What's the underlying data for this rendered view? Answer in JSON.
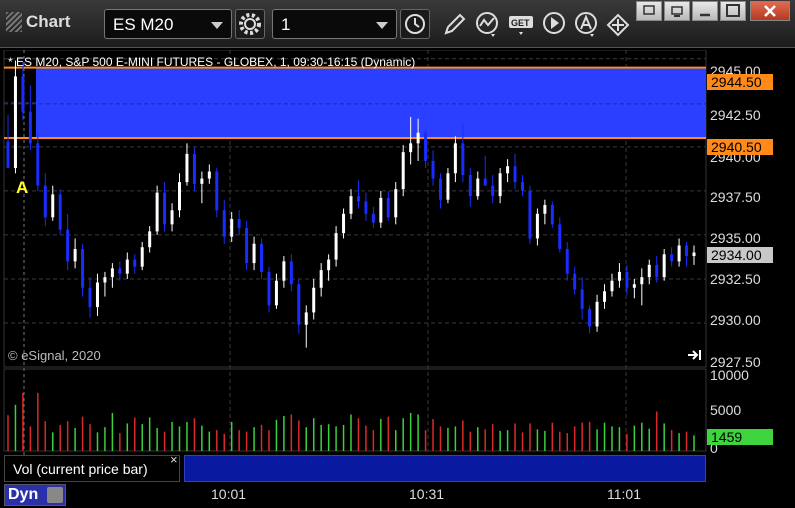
{
  "toolbar": {
    "app_title": "Chart",
    "symbol": "ES M20",
    "interval": "1",
    "icons": [
      "clock-icon",
      "pencil-icon",
      "study-icon",
      "get-icon",
      "play-icon",
      "alert-icon",
      "arrows-icon"
    ]
  },
  "window": {
    "buttons": [
      "restore",
      "minimize",
      "maximize",
      "close"
    ]
  },
  "chart_info": {
    "title_line": "* ES M20, S&P 500 E-MINI FUTURES - GLOBEX, 1, 09:30-16:15 (Dynamic)",
    "copyright": "© eSignal, 2020",
    "marker": "A"
  },
  "price_axis": {
    "labels": [
      "2945.00",
      "2942.50",
      "2940.00",
      "2937.50",
      "2935.00",
      "2932.50",
      "2930.00",
      "2927.50"
    ],
    "tag_high": "2944.50",
    "tag_low": "2940.50",
    "tag_last": "2934.00"
  },
  "volume_axis": {
    "labels": [
      "10000",
      "5000",
      "0"
    ],
    "tag_last": "1459"
  },
  "volume_panel": {
    "label": "Vol (current price bar)",
    "close": "×"
  },
  "time_axis": {
    "labels": [
      "10:01",
      "10:31",
      "11:01"
    ]
  },
  "bottom": {
    "dyn_label": "Dyn"
  },
  "colors": {
    "up": "#ffffff",
    "down": "#1a2cff",
    "zone": "#2a3fff",
    "zone_line": "#ff8a1a",
    "vol_up": "#3bd13b",
    "vol_down": "#d92a2a",
    "last_tag": "#c8c8c8",
    "vol_tag": "#3ed43e"
  },
  "chart_data": {
    "type": "candlestick",
    "ylim": [
      2927.5,
      2945.5
    ],
    "zone": [
      2940.5,
      2944.5
    ],
    "candles": [
      [
        2940.3,
        2941.8,
        2939.5,
        2938.8
      ],
      [
        2938.8,
        2944.9,
        2938.5,
        2944.0
      ],
      [
        2944.0,
        2944.8,
        2941.5,
        2942.0
      ],
      [
        2942.0,
        2943.5,
        2939.8,
        2940.2
      ],
      [
        2940.2,
        2940.8,
        2937.5,
        2937.8
      ],
      [
        2937.8,
        2938.5,
        2935.5,
        2936.0
      ],
      [
        2936.0,
        2937.8,
        2935.8,
        2937.3
      ],
      [
        2937.3,
        2937.6,
        2935.0,
        2935.3
      ],
      [
        2935.3,
        2936.2,
        2933.0,
        2933.5
      ],
      [
        2933.5,
        2934.8,
        2933.1,
        2934.2
      ],
      [
        2934.2,
        2934.5,
        2931.5,
        2932.0
      ],
      [
        2932.0,
        2932.6,
        2930.3,
        2930.9
      ],
      [
        2930.9,
        2932.8,
        2930.4,
        2932.3
      ],
      [
        2932.3,
        2932.9,
        2931.5,
        2932.6
      ],
      [
        2932.6,
        2933.4,
        2932.0,
        2933.1
      ],
      [
        2933.1,
        2933.5,
        2932.4,
        2932.8
      ],
      [
        2932.8,
        2934.0,
        2932.5,
        2933.6
      ],
      [
        2933.6,
        2933.9,
        2932.8,
        2933.2
      ],
      [
        2933.2,
        2934.6,
        2933.0,
        2934.3
      ],
      [
        2934.3,
        2935.5,
        2934.0,
        2935.2
      ],
      [
        2935.2,
        2937.8,
        2935.0,
        2937.4
      ],
      [
        2937.4,
        2938.0,
        2935.2,
        2935.6
      ],
      [
        2935.6,
        2936.8,
        2935.2,
        2936.4
      ],
      [
        2936.4,
        2938.5,
        2936.0,
        2938.0
      ],
      [
        2938.0,
        2940.2,
        2937.8,
        2939.6
      ],
      [
        2939.6,
        2940.0,
        2937.5,
        2937.9
      ],
      [
        2937.9,
        2938.6,
        2936.8,
        2938.2
      ],
      [
        2938.2,
        2939.0,
        2937.9,
        2938.6
      ],
      [
        2938.6,
        2938.8,
        2936.0,
        2936.4
      ],
      [
        2936.4,
        2937.0,
        2934.5,
        2934.9
      ],
      [
        2934.9,
        2936.3,
        2934.6,
        2935.9
      ],
      [
        2935.9,
        2936.4,
        2935.0,
        2935.4
      ],
      [
        2935.4,
        2935.8,
        2933.0,
        2933.4
      ],
      [
        2933.4,
        2934.9,
        2933.0,
        2934.5
      ],
      [
        2934.5,
        2934.8,
        2932.5,
        2932.9
      ],
      [
        2932.9,
        2933.2,
        2930.6,
        2931.0
      ],
      [
        2931.0,
        2932.8,
        2930.8,
        2932.4
      ],
      [
        2932.4,
        2933.8,
        2932.0,
        2933.5
      ],
      [
        2933.5,
        2933.9,
        2931.8,
        2932.2
      ],
      [
        2932.2,
        2932.5,
        2929.4,
        2929.9
      ],
      [
        2929.9,
        2931.0,
        2928.6,
        2930.6
      ],
      [
        2930.6,
        2932.5,
        2930.2,
        2932.0
      ],
      [
        2932.0,
        2933.4,
        2931.5,
        2933.0
      ],
      [
        2933.0,
        2933.9,
        2932.4,
        2933.6
      ],
      [
        2933.6,
        2935.5,
        2933.2,
        2935.1
      ],
      [
        2935.1,
        2936.5,
        2934.8,
        2936.2
      ],
      [
        2936.2,
        2937.6,
        2935.9,
        2937.2
      ],
      [
        2937.2,
        2938.1,
        2936.5,
        2936.9
      ],
      [
        2936.9,
        2937.4,
        2935.8,
        2936.2
      ],
      [
        2936.2,
        2936.6,
        2935.4,
        2935.7
      ],
      [
        2935.7,
        2937.5,
        2935.4,
        2937.1
      ],
      [
        2937.1,
        2937.5,
        2935.8,
        2936.0
      ],
      [
        2936.0,
        2938.0,
        2935.6,
        2937.6
      ],
      [
        2937.6,
        2940.1,
        2937.2,
        2939.7
      ],
      [
        2939.7,
        2941.7,
        2939.0,
        2940.2
      ],
      [
        2940.2,
        2941.6,
        2939.2,
        2940.8
      ],
      [
        2940.8,
        2941.0,
        2938.8,
        2939.2
      ],
      [
        2939.2,
        2939.8,
        2937.8,
        2938.2
      ],
      [
        2938.2,
        2938.5,
        2936.5,
        2937.0
      ],
      [
        2937.0,
        2938.8,
        2936.8,
        2938.5
      ],
      [
        2938.5,
        2940.6,
        2938.0,
        2940.2
      ],
      [
        2940.2,
        2941.3,
        2938.0,
        2938.4
      ],
      [
        2938.4,
        2938.8,
        2936.6,
        2937.2
      ],
      [
        2937.2,
        2938.6,
        2937.0,
        2938.2
      ],
      [
        2938.2,
        2939.5,
        2937.8,
        2937.8
      ],
      [
        2937.8,
        2938.4,
        2936.8,
        2937.2
      ],
      [
        2937.2,
        2938.8,
        2936.8,
        2938.5
      ],
      [
        2938.5,
        2939.3,
        2938.0,
        2938.9
      ],
      [
        2938.9,
        2939.6,
        2937.6,
        2938.0
      ],
      [
        2938.0,
        2938.4,
        2937.2,
        2937.5
      ],
      [
        2937.5,
        2937.8,
        2934.5,
        2934.8
      ],
      [
        2934.8,
        2936.5,
        2934.4,
        2936.2
      ],
      [
        2936.2,
        2937.0,
        2935.6,
        2936.7
      ],
      [
        2936.7,
        2936.9,
        2935.4,
        2935.6
      ],
      [
        2935.6,
        2936.0,
        2934.0,
        2934.2
      ],
      [
        2934.2,
        2934.6,
        2932.4,
        2932.8
      ],
      [
        2932.8,
        2933.2,
        2931.6,
        2931.9
      ],
      [
        2931.9,
        2932.6,
        2930.2,
        2930.8
      ],
      [
        2930.8,
        2931.0,
        2929.4,
        2929.8
      ],
      [
        2929.8,
        2931.6,
        2929.5,
        2931.2
      ],
      [
        2931.2,
        2932.2,
        2930.8,
        2931.8
      ],
      [
        2931.8,
        2932.8,
        2931.5,
        2932.4
      ],
      [
        2932.4,
        2933.4,
        2932.0,
        2932.9
      ],
      [
        2932.9,
        2933.3,
        2931.6,
        2932.0
      ],
      [
        2932.0,
        2932.5,
        2931.4,
        2932.2
      ],
      [
        2932.2,
        2933.1,
        2931.0,
        2932.6
      ],
      [
        2932.6,
        2933.6,
        2932.2,
        2933.3
      ],
      [
        2933.3,
        2933.8,
        2932.3,
        2932.6
      ],
      [
        2932.6,
        2934.2,
        2932.4,
        2933.9
      ],
      [
        2933.9,
        2934.3,
        2933.2,
        2933.5
      ],
      [
        2933.5,
        2934.8,
        2933.2,
        2934.4
      ],
      [
        2934.4,
        2934.6,
        2933.2,
        2933.8
      ],
      [
        2933.8,
        2934.4,
        2933.3,
        2934.0
      ]
    ],
    "volumes": [
      4800,
      6200,
      7800,
      3300,
      7800,
      4000,
      2500,
      3500,
      4000,
      3100,
      4600,
      3600,
      2500,
      3200,
      5100,
      2400,
      3700,
      4500,
      3600,
      4500,
      3100,
      2600,
      3900,
      3300,
      3900,
      4400,
      3400,
      2600,
      2800,
      2300,
      3900,
      2800,
      2600,
      3200,
      3500,
      2800,
      4200,
      4700,
      4900,
      4100,
      3200,
      4400,
      3500,
      3600,
      3300,
      3500,
      4900,
      4400,
      3400,
      2800,
      4300,
      4600,
      2800,
      4400,
      5100,
      4900,
      2800,
      4300,
      3300,
      3100,
      3300,
      4100,
      2600,
      3200,
      2900,
      3600,
      2700,
      2800,
      3700,
      2500,
      3700,
      2900,
      2700,
      3800,
      2600,
      2400,
      3300,
      3800,
      3900,
      2900,
      3800,
      3300,
      3200,
      2300,
      3400,
      3800,
      3000,
      5300,
      3700,
      2800,
      2400,
      2600,
      2100
    ],
    "volume_ylim": [
      0,
      11000
    ]
  }
}
